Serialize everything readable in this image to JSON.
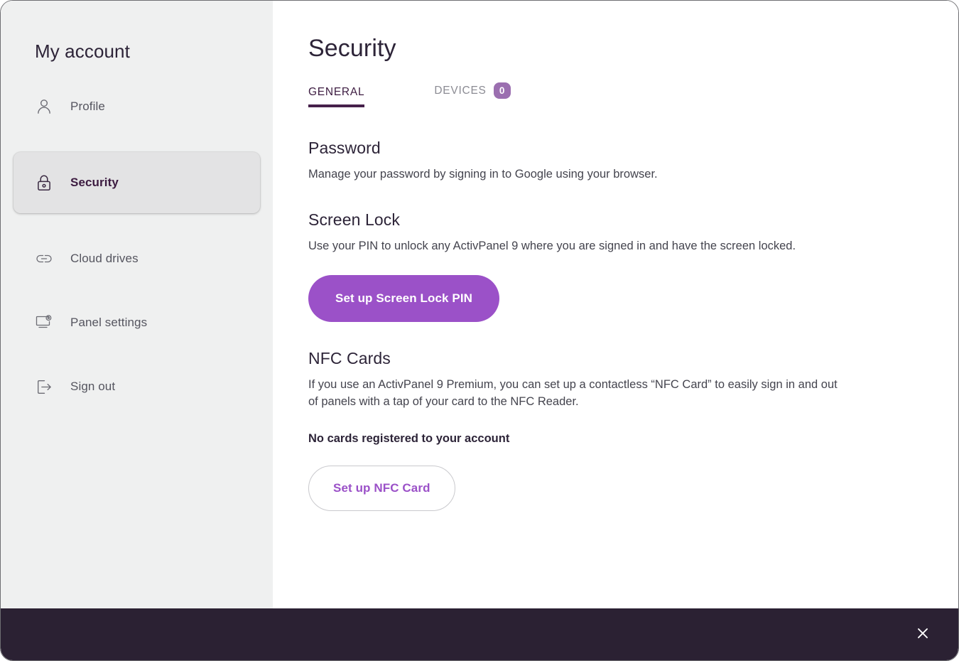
{
  "window": {
    "title": "My account"
  },
  "sidebar": {
    "title": "My account",
    "items": [
      {
        "label": "Profile",
        "icon": "person-icon",
        "selected": false
      },
      {
        "label": "Security",
        "icon": "lock-icon",
        "selected": true
      },
      {
        "label": "Cloud drives",
        "icon": "link-icon",
        "selected": false
      },
      {
        "label": "Panel settings",
        "icon": "monitor-gear-icon",
        "selected": false
      },
      {
        "label": "Sign out",
        "icon": "sign-out-icon",
        "selected": false
      }
    ]
  },
  "main": {
    "page_title": "Security",
    "tabs": [
      {
        "label": "GENERAL",
        "active": true,
        "badge": null
      },
      {
        "label": "DEVICES",
        "active": false,
        "badge": "0"
      }
    ],
    "sections": [
      {
        "heading": "Password",
        "body": "Manage your password by signing in to Google using your browser."
      },
      {
        "heading": "Screen Lock",
        "body": "Use your PIN to unlock any ActivPanel 9 where you are signed in and have the screen locked.",
        "primary_button": "Set up Screen Lock PIN"
      },
      {
        "heading": "NFC Cards",
        "body": "If you use an ActivPanel 9 Premium, you can set up a contactless “NFC Card” to easily sign in and out of panels with a tap of your card to the NFC Reader.",
        "status": "No cards registered to your account",
        "outline_button": "Set up NFC Card"
      }
    ]
  },
  "bottom_bar": {
    "close_icon": "close-icon"
  },
  "colors": {
    "accent_purple": "#9b51c8",
    "badge_purple": "#9b6fb0",
    "tab_underline": "#46204a",
    "sidebar_bg": "#eff0f0",
    "selected_item_bg": "#e3e3e4",
    "bottom_bar_bg": "#2b2133",
    "heading_text": "#2d2438",
    "body_text": "#44444e"
  }
}
